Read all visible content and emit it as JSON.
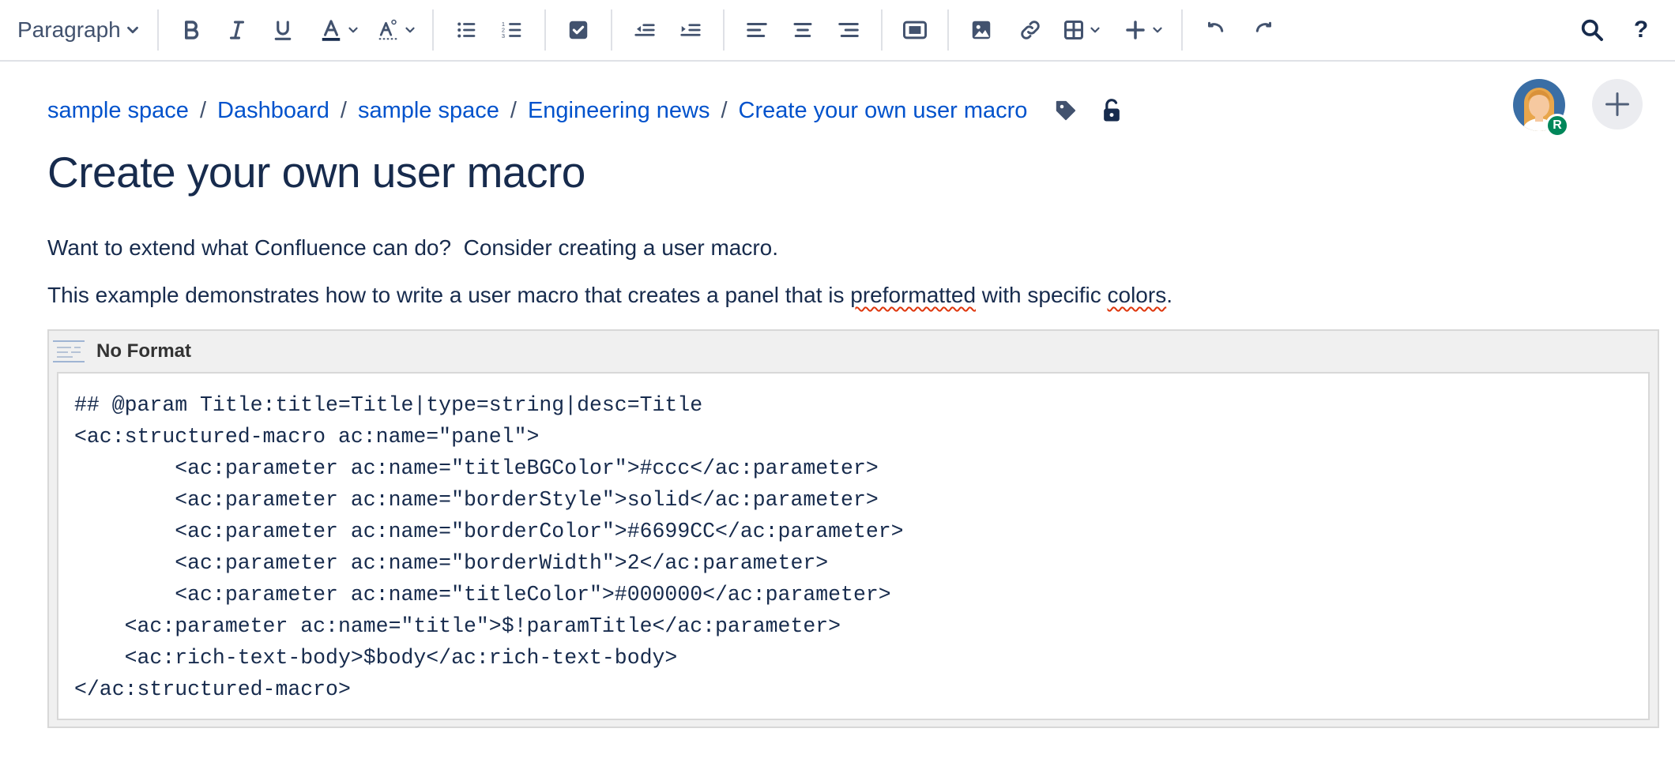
{
  "toolbar": {
    "paragraph_label": "Paragraph",
    "icons": [
      "chevron-down-icon",
      "bold-icon",
      "italic-icon",
      "underline-icon",
      "text-color-icon",
      "clear-format-icon",
      "bullet-list-icon",
      "numbered-list-icon",
      "task-list-icon",
      "outdent-icon",
      "indent-icon",
      "align-left-icon",
      "align-center-icon",
      "align-right-icon",
      "layout-icon",
      "image-icon",
      "link-icon",
      "table-icon",
      "plus-icon",
      "undo-icon",
      "redo-icon",
      "search-icon",
      "help-icon"
    ],
    "text_color": "#172b4d",
    "help_label": "?"
  },
  "breadcrumb": {
    "items": [
      "sample space",
      "Dashboard",
      "sample space",
      "Engineering news",
      "Create your own user macro"
    ],
    "separator": "/"
  },
  "avatar": {
    "badge": "R"
  },
  "page": {
    "title": "Create your own user macro",
    "para1": "Want to extend what Confluence can do?  Consider creating a user macro.",
    "para2_a": "This example demonstrates how to write a user macro that creates a panel that is ",
    "para2_b": "preformatted",
    "para2_c": " with specific ",
    "para2_d": "colors",
    "para2_e": "."
  },
  "macro": {
    "title": "No Format",
    "code": "## @param Title:title=Title|type=string|desc=Title\n<ac:structured-macro ac:name=\"panel\">\n        <ac:parameter ac:name=\"titleBGColor\">#ccc</ac:parameter>\n        <ac:parameter ac:name=\"borderStyle\">solid</ac:parameter>\n        <ac:parameter ac:name=\"borderColor\">#6699CC</ac:parameter>\n        <ac:parameter ac:name=\"borderWidth\">2</ac:parameter>\n        <ac:parameter ac:name=\"titleColor\">#000000</ac:parameter>\n    <ac:parameter ac:name=\"title\">$!paramTitle</ac:parameter>\n    <ac:rich-text-body>$body</ac:rich-text-body>\n</ac:structured-macro>"
  },
  "colors": {
    "link": "#0052cc",
    "icon": "#42526e",
    "badge": "#00875a",
    "spellcheck": "#de350b"
  }
}
